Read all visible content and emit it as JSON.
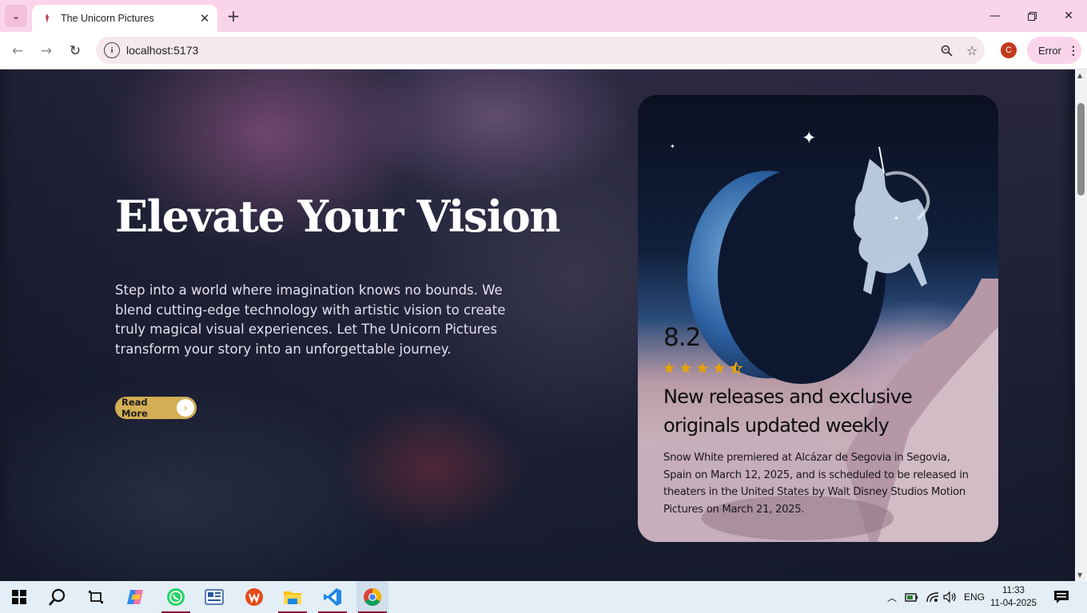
{
  "browser": {
    "tab_title": "The Unicorn Pictures",
    "url": "localhost:5173",
    "profile_initial": "C",
    "error_label": "Error"
  },
  "hero": {
    "title": "Elevate Your Vision",
    "description": "Step into a world where imagination knows no bounds. We blend cutting-edge technology with artistic vision to create truly magical visual experiences. Let The Unicorn Pictures transform your story into an unforgettable journey.",
    "cta_label": "Read More"
  },
  "card": {
    "rating": "8.2",
    "stars": 4.5,
    "headline": "New releases and exclusive originals updated weekly",
    "body": "Snow White premiered at Alcázar de Segovia in Segovia, Spain on March 12, 2025, and is scheduled to be released in theaters in the United States by Walt Disney Studios Motion Pictures on March 21, 2025."
  },
  "taskbar": {
    "language": "ENG",
    "time": "11:33",
    "date": "11-04-2025"
  },
  "colors": {
    "accent_gold": "#d4ae55",
    "star_gold": "#e8a200",
    "tab_bar_pink": "#fad4ea"
  }
}
